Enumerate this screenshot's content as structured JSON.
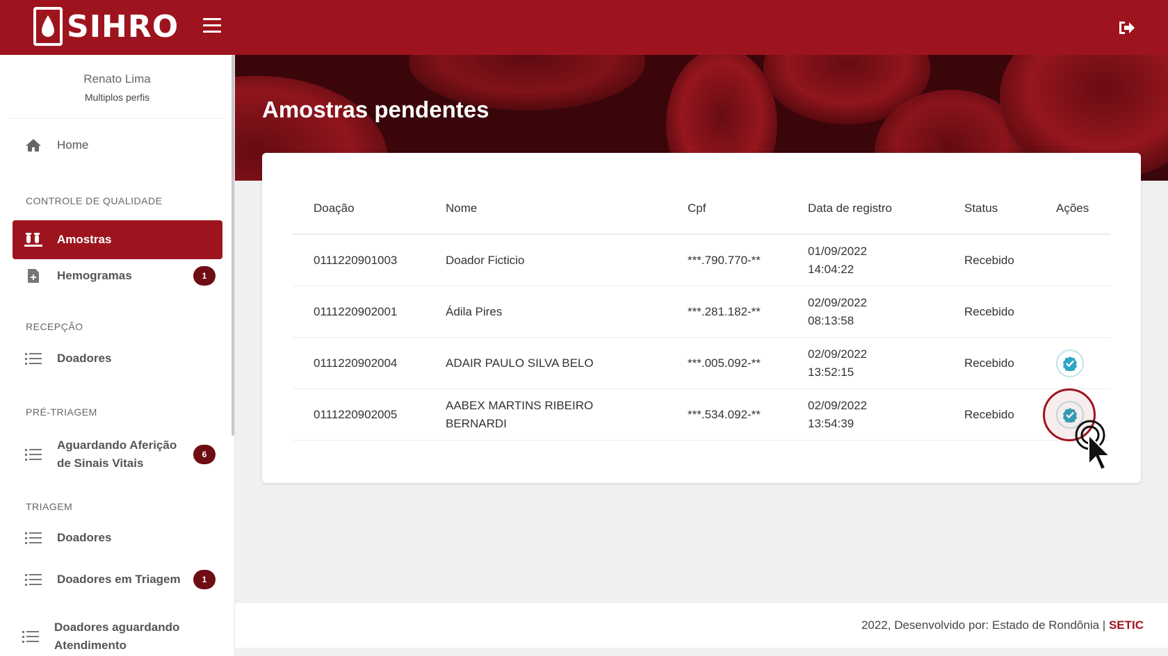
{
  "app": {
    "logo_text": "SIHRO",
    "brand_color": "#9e141e"
  },
  "user": {
    "name": "Renato Lima",
    "role": "Multiplos perfis"
  },
  "sidebar": {
    "home": "Home",
    "sections": [
      {
        "title": "CONTROLE DE QUALIDADE"
      },
      {
        "title": "RECEPÇÃO"
      },
      {
        "title": "PRÉ-TRIAGEM"
      },
      {
        "title": "TRIAGEM"
      }
    ],
    "items": [
      {
        "label": "Amostras",
        "icon": "test-tubes-icon",
        "active": true
      },
      {
        "label": "Hemogramas",
        "icon": "file-plus-icon",
        "badge": "1"
      },
      {
        "label": "Doadores",
        "icon": "list-icon"
      },
      {
        "label": "Aguardando Aferição de Sinais Vitais",
        "icon": "list-icon",
        "badge": "6"
      },
      {
        "label": "Doadores",
        "icon": "list-icon"
      },
      {
        "label": "Doadores em Triagem",
        "icon": "list-icon",
        "badge": "1"
      },
      {
        "label": "Doadores aguardando Atendimento",
        "icon": "list-icon"
      }
    ]
  },
  "page": {
    "title": "Amostras pendentes"
  },
  "table": {
    "headers": [
      "Doação",
      "Nome",
      "Cpf",
      "Data de registro",
      "Status",
      "Ações"
    ],
    "rows": [
      {
        "doacao": "0111220901003",
        "nome": "Doador Ficticio",
        "cpf": "***.790.770-**",
        "data": "01/09/2022",
        "hora": "14:04:22",
        "status": "Recebido",
        "action": false
      },
      {
        "doacao": "0111220902001",
        "nome": "Ádila Pires",
        "cpf": "***.281.182-**",
        "data": "02/09/2022",
        "hora": "08:13:58",
        "status": "Recebido",
        "action": false
      },
      {
        "doacao": "0111220902004",
        "nome": "ADAIR PAULO SILVA BELO",
        "cpf": "***.005.092-**",
        "data": "02/09/2022",
        "hora": "13:52:15",
        "status": "Recebido",
        "action": true
      },
      {
        "doacao": "0111220902005",
        "nome": "AABEX MARTINS RIBEIRO BERNARDI",
        "cpf": "***.534.092-**",
        "data": "02/09/2022",
        "hora": "13:54:39",
        "status": "Recebido",
        "action": true
      }
    ]
  },
  "footer": {
    "text": "2022, Desenvolvido por: Estado de Rondônia |",
    "brand": "SETIC"
  }
}
